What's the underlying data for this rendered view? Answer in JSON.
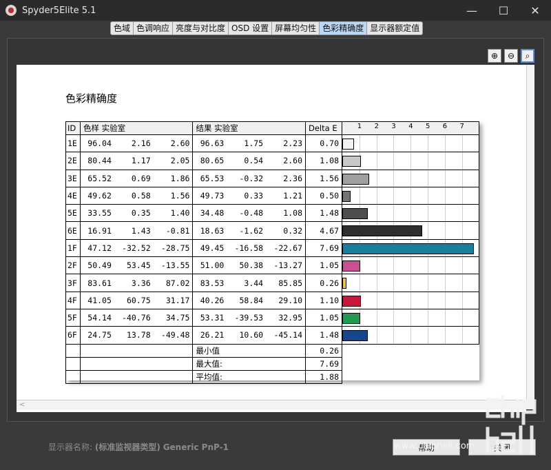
{
  "window": {
    "title": "Spyder5Elite 5.1",
    "minimize": "—",
    "maximize": "☐",
    "close": "✕"
  },
  "tabs": [
    "色域",
    "色调响应",
    "亮度与对比度",
    "OSD 设置",
    "屏幕均匀性",
    "色彩精确度",
    "显示器额定值"
  ],
  "active_tab": 5,
  "zoom": {
    "in": "⊕",
    "out": "⊖",
    "fit": "⌕"
  },
  "report": {
    "title": "色彩精确度",
    "headers": {
      "id": "ID",
      "sample": "色样 实验室",
      "result": "结果 实验室",
      "delta": "Delta E"
    },
    "axis_ticks": [
      "1",
      "2",
      "3",
      "4",
      "5",
      "6",
      "7"
    ],
    "rows": [
      {
        "id": "1E",
        "s": [
          "96.04",
          "2.16",
          "2.60"
        ],
        "r": [
          "96.63",
          "1.75",
          "2.23"
        ],
        "d": "0.70",
        "color": "#f2f2f2"
      },
      {
        "id": "2E",
        "s": [
          "80.44",
          "1.17",
          "2.05"
        ],
        "r": [
          "80.65",
          "0.54",
          "2.60"
        ],
        "d": "1.08",
        "color": "#c8c8c8"
      },
      {
        "id": "3E",
        "s": [
          "65.52",
          "0.69",
          "1.86"
        ],
        "r": [
          "65.53",
          "-0.32",
          "2.36"
        ],
        "d": "1.56",
        "color": "#a0a0a0"
      },
      {
        "id": "4E",
        "s": [
          "49.62",
          "0.58",
          "1.56"
        ],
        "r": [
          "49.73",
          "0.33",
          "1.21"
        ],
        "d": "0.50",
        "color": "#767676"
      },
      {
        "id": "5E",
        "s": [
          "33.55",
          "0.35",
          "1.40"
        ],
        "r": [
          "34.48",
          "-0.48",
          "1.08"
        ],
        "d": "1.48",
        "color": "#4e4e4e"
      },
      {
        "id": "6E",
        "s": [
          "16.91",
          "1.43",
          "-0.81"
        ],
        "r": [
          "18.63",
          "-1.62",
          "0.32"
        ],
        "d": "4.67",
        "color": "#2e2e2e"
      },
      {
        "id": "1F",
        "s": [
          "47.12",
          "-32.52",
          "-28.75"
        ],
        "r": [
          "49.45",
          "-16.58",
          "-22.67"
        ],
        "d": "7.69",
        "color": "#1a7f9a"
      },
      {
        "id": "2F",
        "s": [
          "50.49",
          "53.45",
          "-13.55"
        ],
        "r": [
          "51.00",
          "50.38",
          "-13.27"
        ],
        "d": "1.05",
        "color": "#cc4f91"
      },
      {
        "id": "3F",
        "s": [
          "83.61",
          "3.36",
          "87.02"
        ],
        "r": [
          "83.53",
          "3.44",
          "85.85"
        ],
        "d": "0.26",
        "color": "#f0c53c"
      },
      {
        "id": "4F",
        "s": [
          "41.05",
          "60.75",
          "31.17"
        ],
        "r": [
          "40.26",
          "58.84",
          "29.10"
        ],
        "d": "1.10",
        "color": "#c8183c"
      },
      {
        "id": "5F",
        "s": [
          "54.14",
          "-40.76",
          "34.75"
        ],
        "r": [
          "53.31",
          "-39.53",
          "32.95"
        ],
        "d": "1.05",
        "color": "#1e9a4e"
      },
      {
        "id": "6F",
        "s": [
          "24.75",
          "13.78",
          "-49.48"
        ],
        "r": [
          "26.21",
          "10.60",
          "-45.14"
        ],
        "d": "1.48",
        "color": "#16468c"
      }
    ],
    "summary": [
      {
        "label": "最小值",
        "value": "0.26"
      },
      {
        "label": "最大值:",
        "value": "7.69"
      },
      {
        "label": "平均值:",
        "value": "1.88"
      }
    ]
  },
  "footer": {
    "label": "显示器名称:",
    "type": "(标准监视器类型)",
    "name": "Generic PnP-1",
    "btn_next": "帮助",
    "btn_close": "关闭"
  },
  "watermark": "www.chiphell.com"
}
